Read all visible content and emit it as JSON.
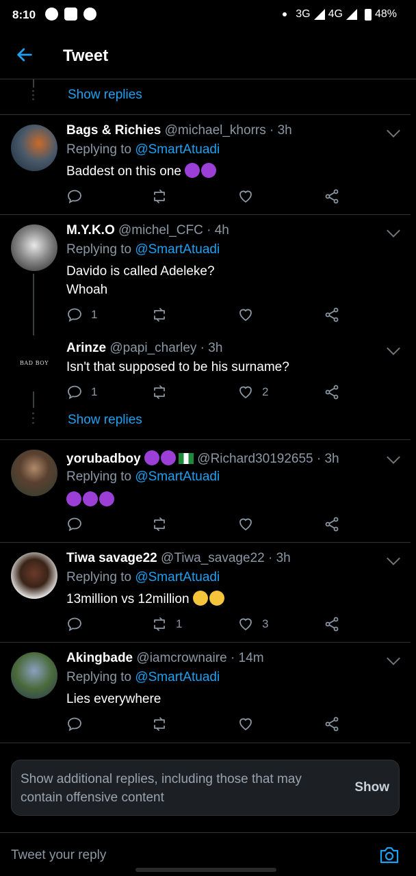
{
  "status": {
    "time": "8:10",
    "network": "3G",
    "network2": "4G",
    "battery": "48%"
  },
  "header": {
    "title": "Tweet"
  },
  "show_replies_1": "Show replies",
  "show_replies_2": "Show replies",
  "tweets": [
    {
      "name": "Bags & Richies",
      "meta": "@michael_khorrs · 3h",
      "replying": "Replying to",
      "mention": "@SmartAtuadi",
      "text": "Baddest on this one",
      "reply_count": "",
      "retweet_count": "",
      "like_count": ""
    },
    {
      "name": "M.Y.K.O",
      "meta": "@michel_CFC · 4h",
      "replying": "Replying to",
      "mention": "@SmartAtuadi",
      "text_line1": "Davido is called Adeleke?",
      "text_line2": "Whoah",
      "reply_count": "1",
      "retweet_count": "",
      "like_count": ""
    },
    {
      "name": "Arinze",
      "meta": "@papi_charley · 3h",
      "avatar_text": "BAD BOY",
      "text": "Isn't that supposed to be his surname?",
      "reply_count": "1",
      "retweet_count": "",
      "like_count": "2"
    },
    {
      "name": "yorubadboy",
      "meta": "@Richard30192655 · 3h",
      "replying": "Replying to",
      "mention": "@SmartAtuadi",
      "reply_count": "",
      "retweet_count": "",
      "like_count": ""
    },
    {
      "name": "Tiwa savage22",
      "meta": "@Tiwa_savage22 · 3h",
      "replying": "Replying to",
      "mention": "@SmartAtuadi",
      "text": "13million vs 12million",
      "reply_count": "",
      "retweet_count": "1",
      "like_count": "3"
    },
    {
      "name": "Akingbade",
      "meta": "@iamcrownaire · 14m",
      "replying": "Replying to",
      "mention": "@SmartAtuadi",
      "text": "Lies everywhere",
      "reply_count": "",
      "retweet_count": "",
      "like_count": ""
    }
  ],
  "notice": {
    "text": "Show additional replies, including those that may contain offensive content",
    "button": "Show"
  },
  "composer": {
    "placeholder": "Tweet your reply"
  },
  "colors": {
    "accent": "#1da1f2",
    "background": "#000000",
    "divider": "#2f3336",
    "muted": "#8b98a5"
  }
}
